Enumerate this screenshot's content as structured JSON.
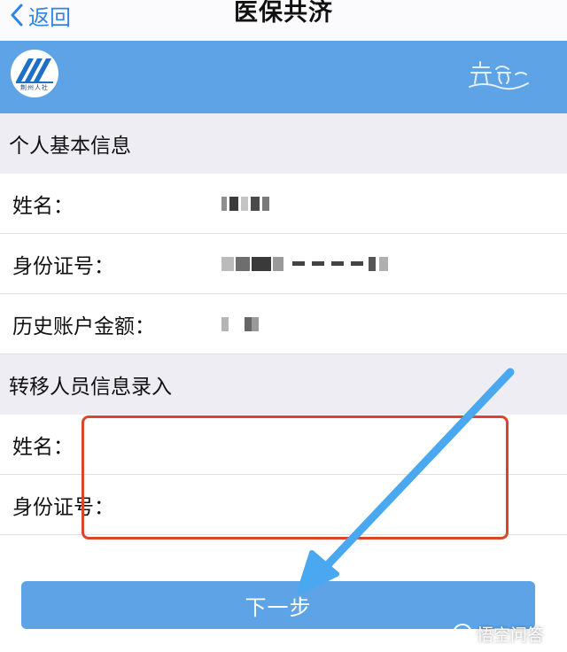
{
  "nav": {
    "back_label": "返回",
    "title": "医保共济"
  },
  "banner": {
    "logo_text": "荆州人社",
    "accent": "#5da3e6"
  },
  "personal_info": {
    "header": "个人基本信息",
    "fields": [
      {
        "label": "姓名：",
        "value": "",
        "masked": true
      },
      {
        "label": "身份证号：",
        "value": "",
        "masked": true
      },
      {
        "label": "历史账户金额：",
        "value": "",
        "masked": true
      }
    ]
  },
  "transfer_info": {
    "header": "转移人员信息录入",
    "name_label": "姓名：",
    "name_value": "",
    "id_label": "身份证号：",
    "id_value": ""
  },
  "next_button": "下一步",
  "watermark": "悟空问答",
  "colors": {
    "link_blue": "#2f84e8",
    "highlight_red": "#d9462e",
    "arrow_blue": "#4aa8f0"
  }
}
